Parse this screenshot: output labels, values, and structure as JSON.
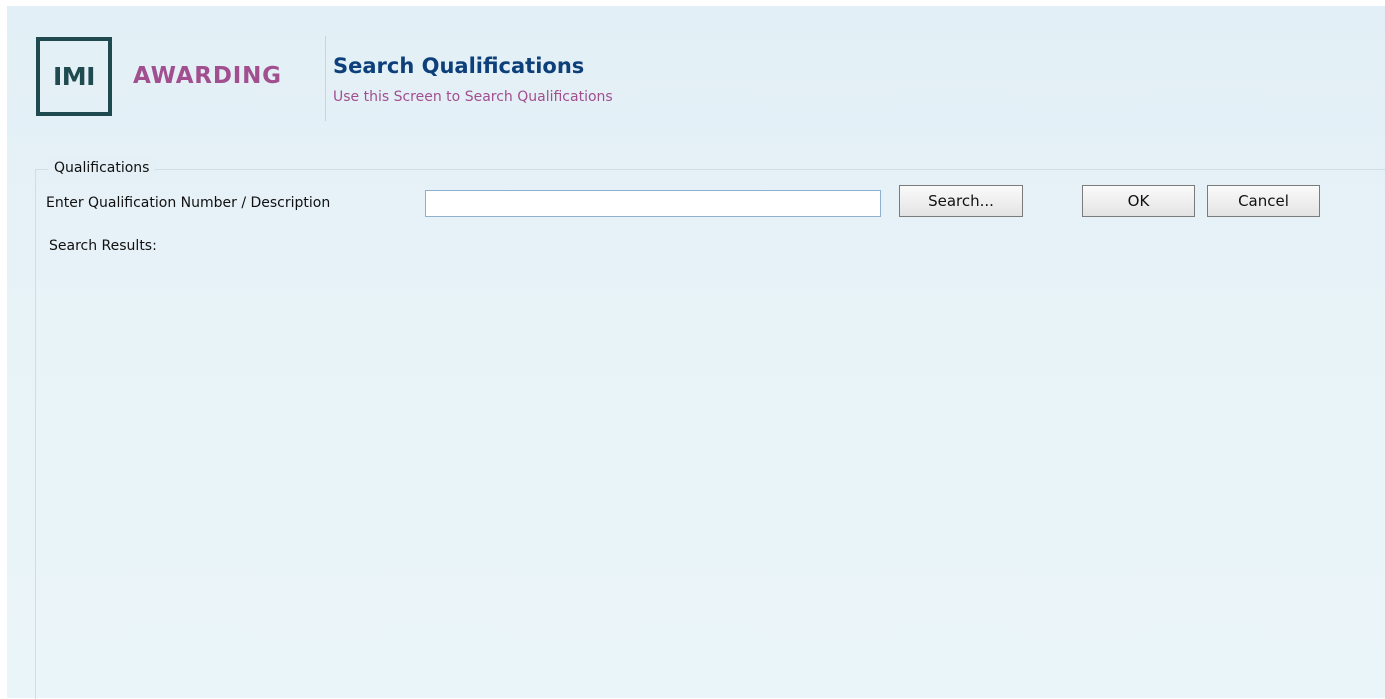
{
  "logo": {
    "mark": "IMI",
    "wordmark": "AWARDING"
  },
  "header": {
    "title": "Search Qualifications",
    "subtitle": "Use this Screen to Search Qualifications"
  },
  "form": {
    "legend": "Qualifications",
    "search_label": "Enter Qualification Number / Description",
    "search_value": "",
    "search_placeholder": "",
    "search_button": "Search...",
    "ok_button": "OK",
    "cancel_button": "Cancel",
    "results_label": "Search Results:"
  },
  "colors": {
    "title": "#0d3f7a",
    "accent": "#a14f8e",
    "logo_teal": "#1f4a50",
    "background": "#e4f0f6"
  }
}
